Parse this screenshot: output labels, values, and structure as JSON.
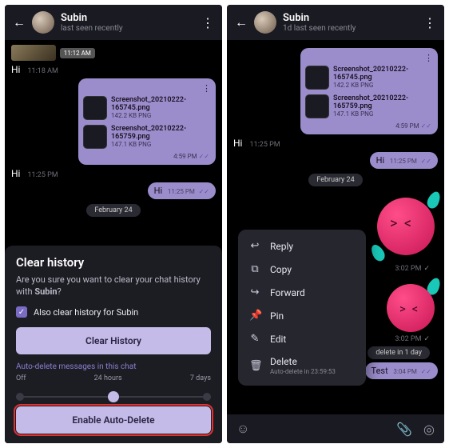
{
  "left": {
    "header": {
      "name": "Subin",
      "status": "last seen recently"
    },
    "first_ts_badge": "11:12 AM",
    "hi1": "Hi",
    "hi1_time": "11:18 AM",
    "attachments": [
      {
        "name": "Screenshot_20210222-165745.png",
        "meta": "142.2 KB PNG"
      },
      {
        "name": "Screenshot_20210222-165759.png",
        "meta": "147.1 KB PNG"
      }
    ],
    "att_time": "4:59 PM",
    "hi2": "Hi",
    "hi2_time": "11:25 PM",
    "out_hi": "Hi",
    "out_hi_time": "11:25 PM",
    "date": "February 24",
    "sheet": {
      "title": "Clear history",
      "msg_a": "Are you sure you want to clear your chat history with ",
      "msg_b": "Subin",
      "msg_c": "?",
      "also": "Also clear history for Subin",
      "clear_btn": "Clear History",
      "auto_label": "Auto-delete messages in this chat",
      "s_off": "Off",
      "s_24": "24 hours",
      "s_7": "7 days",
      "enable_btn": "Enable Auto-Delete"
    }
  },
  "right": {
    "header": {
      "name": "Subin",
      "age": "1d",
      "status": "last seen recently"
    },
    "attachments": [
      {
        "name": "Screenshot_20210222-165745.png",
        "meta": "142.2 KB PNG"
      },
      {
        "name": "Screenshot_20210222-165759.png",
        "meta": "147.1 KB PNG"
      }
    ],
    "att_time": "4:59 PM",
    "hi_in": "Hi",
    "hi_in_time": "11:25 PM",
    "out_hi": "Hi",
    "out_hi_time": "11:25 PM",
    "date": "February 24",
    "sticker1_time": "3:02 PM",
    "sticker2_time": "3:02 PM",
    "ad_chip": "delete in 1 day",
    "test": "Test",
    "test_time": "3:04 PM",
    "menu": {
      "reply": "Reply",
      "copy": "Copy",
      "forward": "Forward",
      "pin": "Pin",
      "edit": "Edit",
      "delete": "Delete",
      "delete_sub": "Auto-delete in 23:59:53"
    }
  }
}
